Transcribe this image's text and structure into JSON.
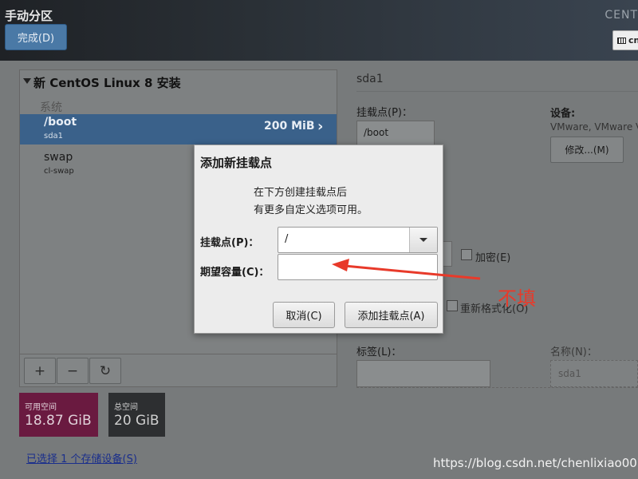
{
  "header": {
    "title": "手动分区",
    "done_label": "完成(D)",
    "brand_label": "CENT",
    "keyboard_label": "cn"
  },
  "partitions": {
    "root_title": "新 CentOS Linux 8 安装",
    "section_label": "系统",
    "items": [
      {
        "name": "/boot",
        "device": "sda1",
        "size": "200 MiB",
        "selected": true
      },
      {
        "name": "swap",
        "device": "cl-swap",
        "size": "",
        "selected": false
      }
    ],
    "toolbar": {
      "add": "+",
      "remove": "−",
      "refresh": "↻"
    }
  },
  "storage": {
    "available_label": "可用空间",
    "available_value": "18.87 GiB",
    "total_label": "总空间",
    "total_value": "20 GiB",
    "selected_link": "已选择 1 个存储设备(S)"
  },
  "details": {
    "title": "sda1",
    "mount_label": "挂载点(P)：",
    "mount_value": "/boot",
    "device_label": "设备:",
    "device_value": "VMware, VMware V",
    "modify_label": "修改...(M)",
    "encrypt_label": "加密(E)",
    "reformat_label": "重新格式化(O)",
    "tag_label": "标签(L)：",
    "name_label": "名称(N)：",
    "name_placeholder": "sda1"
  },
  "dialog": {
    "title": "添加新挂载点",
    "desc_line1": "在下方创建挂载点后",
    "desc_line2": "有更多自定义选项可用。",
    "mount_label": "挂载点(P)：",
    "mount_value": "/",
    "capacity_label": "期望容量(C)：",
    "capacity_value": "",
    "cancel_label": "取消(C)",
    "add_label": "添加挂载点(A)"
  },
  "annotation": {
    "text": "不填",
    "color": "#e83a2a"
  },
  "watermark": "https://blog.csdn.net/chenlixiao007"
}
